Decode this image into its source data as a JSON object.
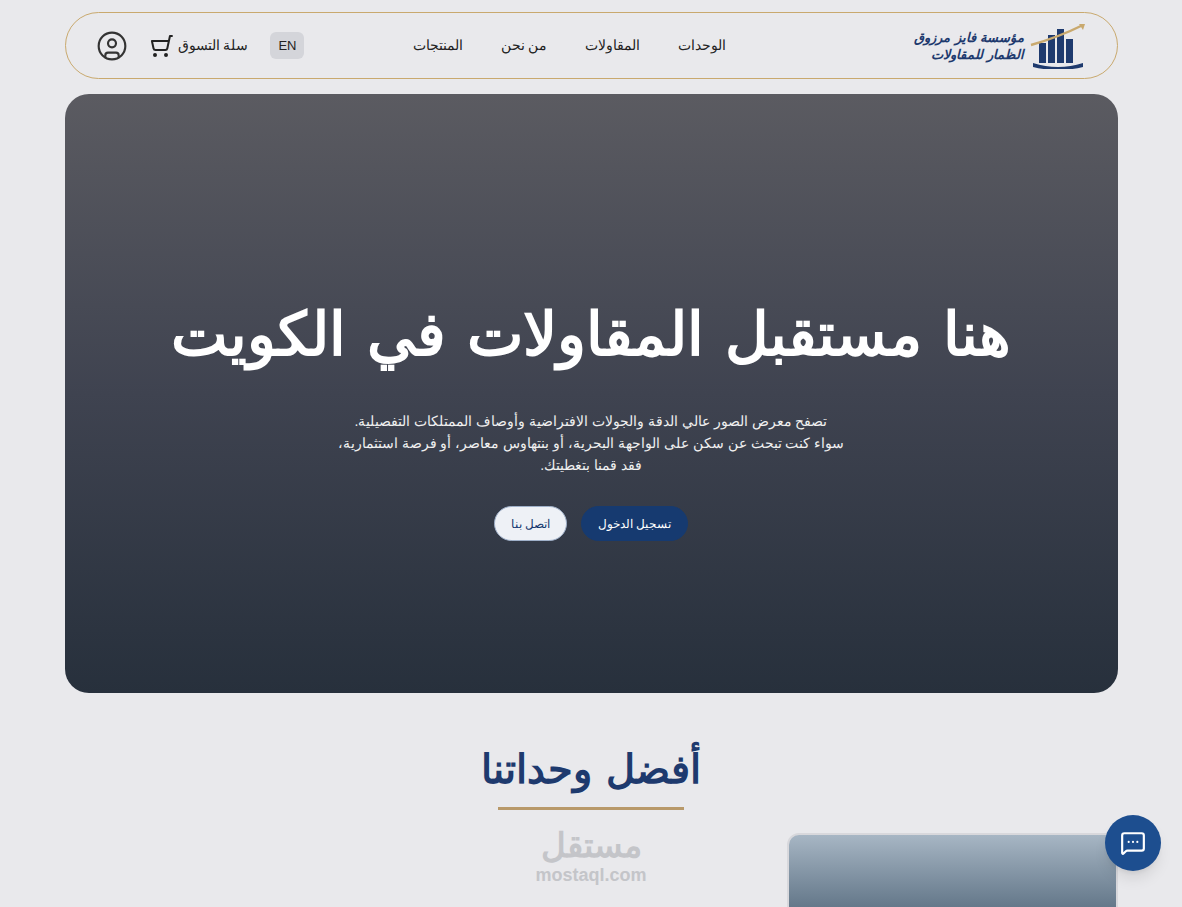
{
  "header": {
    "logo": {
      "line1": "مؤسسة فايز مرزوق",
      "line2": "الظمار للمقاولات"
    },
    "nav": [
      "الوحدات",
      "المقاولات",
      "من نحن",
      "المنتجات"
    ],
    "language": "EN",
    "cart": "سلة التسوق"
  },
  "hero": {
    "title": "هنا مستقبل المقاولات في الكويت",
    "description": [
      "تصفح معرض الصور عالي الدقة والجولات الافتراضية وأوصاف الممتلكات التفصيلية.",
      "سواء كنت تبحث عن سكن على الواجهة البحرية، أو بنتهاوس معاصر، أو فرصة استثمارية،",
      "فقد قمنا بتغطيتك."
    ],
    "buttons": [
      {
        "label": "تسجيل الدخول",
        "kind": "primary"
      },
      {
        "label": "اتصل بنا",
        "kind": "secondary"
      }
    ]
  },
  "section": {
    "title": "أفضل وحداتنا"
  },
  "watermark": {
    "arabic": "مستقل",
    "latin": "mostaql.com"
  }
}
